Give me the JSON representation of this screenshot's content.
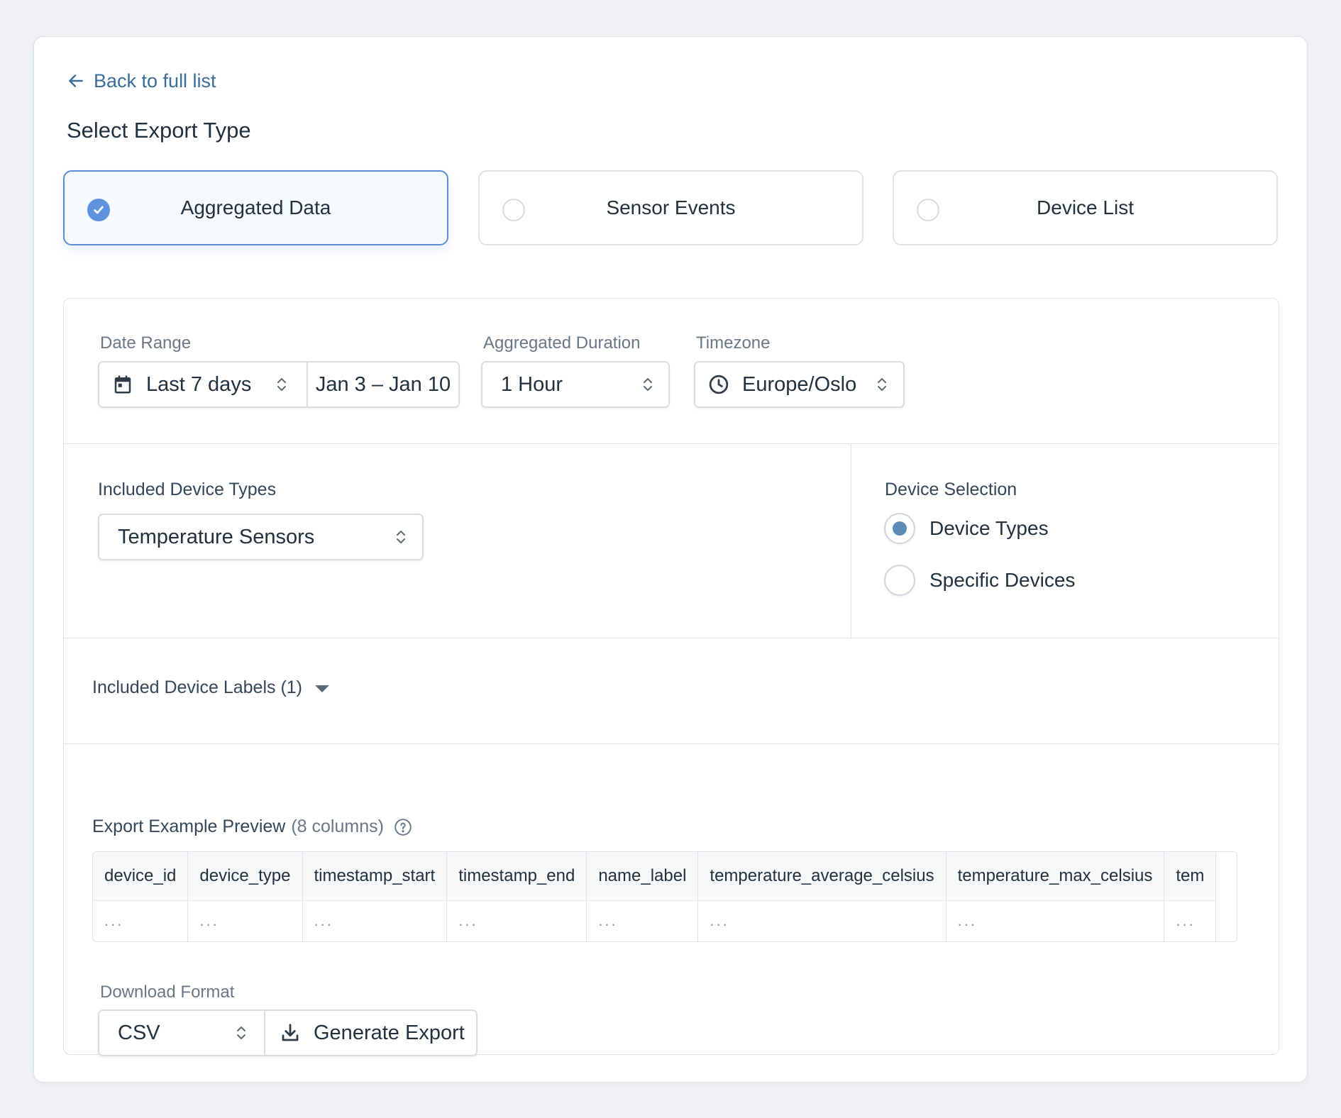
{
  "nav": {
    "back_label": "Back to full list"
  },
  "page": {
    "title": "Select Export Type"
  },
  "export_types": [
    {
      "label": "Aggregated Data",
      "selected": true
    },
    {
      "label": "Sensor Events",
      "selected": false
    },
    {
      "label": "Device List",
      "selected": false
    }
  ],
  "filters": {
    "date_range_label": "Date Range",
    "date_range_value": "Last 7 days",
    "date_range_dates": "Jan 3 – Jan 10",
    "duration_label": "Aggregated Duration",
    "duration_value": "1 Hour",
    "timezone_label": "Timezone",
    "timezone_value": "Europe/Oslo"
  },
  "device_types": {
    "label": "Included Device Types",
    "value": "Temperature Sensors"
  },
  "device_selection": {
    "label": "Device Selection",
    "options": [
      {
        "label": "Device Types",
        "checked": true
      },
      {
        "label": "Specific Devices",
        "checked": false
      }
    ]
  },
  "labels_section": {
    "title": "Included Device Labels (1)"
  },
  "preview": {
    "title": "Export Example Preview",
    "subtitle": "(8 columns)",
    "columns": [
      "device_id",
      "device_type",
      "timestamp_start",
      "timestamp_end",
      "name_label",
      "temperature_average_celsius",
      "temperature_max_celsius",
      "tem"
    ],
    "placeholder_cell": "..."
  },
  "download": {
    "label": "Download Format",
    "format_value": "CSV",
    "generate_label": "Generate Export"
  },
  "colors": {
    "accent": "#5e92de",
    "link": "#3b6d9a",
    "radio_dot": "#5e8cb8"
  }
}
